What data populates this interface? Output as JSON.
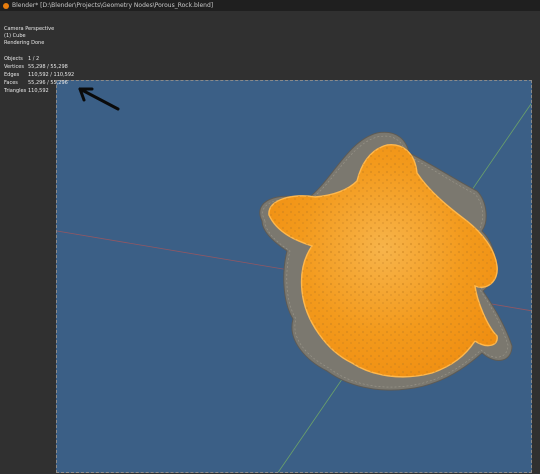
{
  "window": {
    "title": "Blender* [D:\\Blender\\Projects\\Geometry Nodes\\Porous_Rock.blend]"
  },
  "viewport": {
    "overlay": {
      "view": "Camera Perspective",
      "object": "(1) Cube",
      "status": "Rendering Done"
    },
    "stats": [
      {
        "label": "Objects",
        "value": "1 / 2"
      },
      {
        "label": "Vertices",
        "value": "55,298 / 55,298"
      },
      {
        "label": "Edges",
        "value": "110,592 / 110,592"
      },
      {
        "label": "Faces",
        "value": "55,296 / 55,296"
      },
      {
        "label": "Triangles",
        "value": "110,592"
      }
    ]
  },
  "colors": {
    "background": "#3b5f86",
    "selection": "#f39a1c",
    "rock": "#7b786f",
    "axis_x": "#b85353",
    "axis_y": "#7cb95f"
  }
}
